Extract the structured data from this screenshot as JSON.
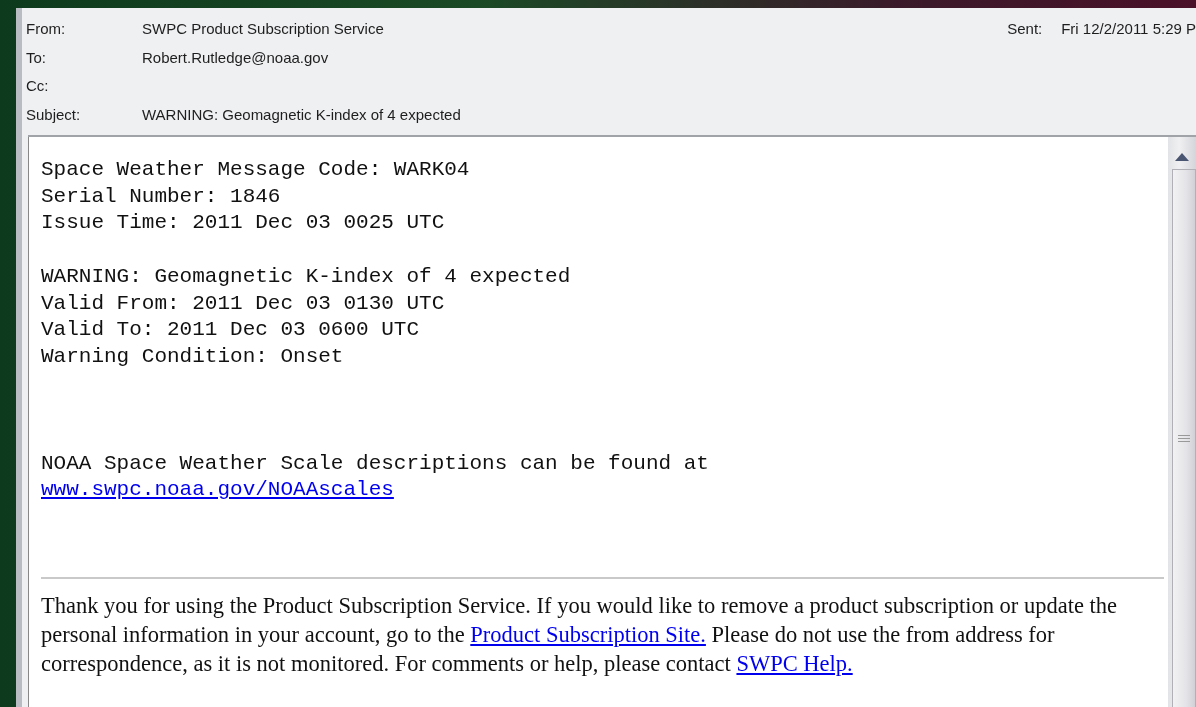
{
  "header": {
    "fields": [
      {
        "label": "From:",
        "value": "SWPC Product Subscription Service"
      },
      {
        "label": "To:",
        "value": "Robert.Rutledge@noaa.gov"
      },
      {
        "label": "Cc:"
      },
      {
        "label": "Subject:",
        "value": "WARNING: Geomagnetic K-index of 4 expected"
      }
    ],
    "sent": {
      "label": "Sent:",
      "value": "Fri 12/2/2011 5:29 P"
    }
  },
  "message": {
    "blocks": [
      {
        "lines": [
          {
            "kind": "text",
            "text": "Space Weather Message Code: WARK04"
          },
          {
            "kind": "text",
            "text": "Serial Number: 1846"
          },
          {
            "kind": "text",
            "text": "Issue Time: 2011 Dec 03 0025 UTC"
          }
        ]
      },
      {
        "lines": [
          {
            "kind": "text",
            "text": "WARNING: Geomagnetic K-index of 4 expected"
          },
          {
            "kind": "text",
            "text": "Valid From: 2011 Dec 03 0130 UTC"
          },
          {
            "kind": "text",
            "text": "Valid To: 2011 Dec 03 0600 UTC"
          },
          {
            "kind": "text",
            "text": "Warning Condition: Onset"
          }
        ]
      },
      {
        "lines": [
          {
            "kind": "text",
            "text": "NOAA Space Weather Scale descriptions can be found at"
          },
          {
            "kind": "link",
            "text": "www.swpc.noaa.gov/NOAAscales"
          }
        ]
      }
    ],
    "footer": [
      {
        "kind": "text",
        "text": "Thank you for using the Product Subscription Service. If you would like to remove a product subscription or update the personal information in your account, go to the "
      },
      {
        "kind": "link",
        "text": "Product Subscription Site."
      },
      {
        "kind": "text",
        "text": " Please do not use the from address for correspondence, as it is not monitored. For comments or help, please contact "
      },
      {
        "kind": "link",
        "text": "SWPC Help."
      }
    ]
  }
}
